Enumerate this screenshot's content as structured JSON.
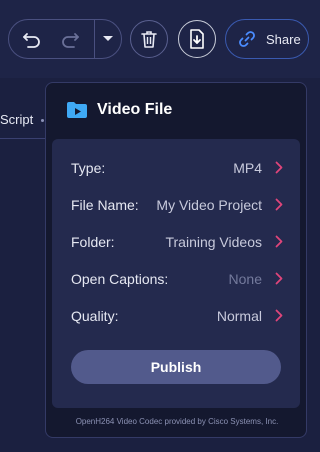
{
  "toolbar": {
    "share_label": "Share",
    "icons": {
      "undo": "undo-icon",
      "redo": "redo-icon",
      "dropdown": "chevron-down-icon",
      "delete": "trash-icon",
      "download": "download-icon",
      "share": "link-icon"
    }
  },
  "sidebar": {
    "script_tab_label": "Script"
  },
  "panel": {
    "title": "Video File",
    "title_icon": "folder-play-icon",
    "rows": [
      {
        "label": "Type:",
        "value": "MP4",
        "muted": false
      },
      {
        "label": "File Name:",
        "value": "My Video Project",
        "muted": false
      },
      {
        "label": "Folder:",
        "value": "Training Videos",
        "muted": false
      },
      {
        "label": "Open Captions:",
        "value": "None",
        "muted": true
      },
      {
        "label": "Quality:",
        "value": "Normal",
        "muted": false
      }
    ],
    "publish_label": "Publish",
    "footer_note": "OpenH264 Video Codec provided by Cisco Systems, Inc."
  },
  "colors": {
    "accent_chevron": "#e0457a",
    "folder_icon": "#3fa9f5",
    "share_icon": "#4a8cff",
    "publish_bg": "#525a8c"
  }
}
